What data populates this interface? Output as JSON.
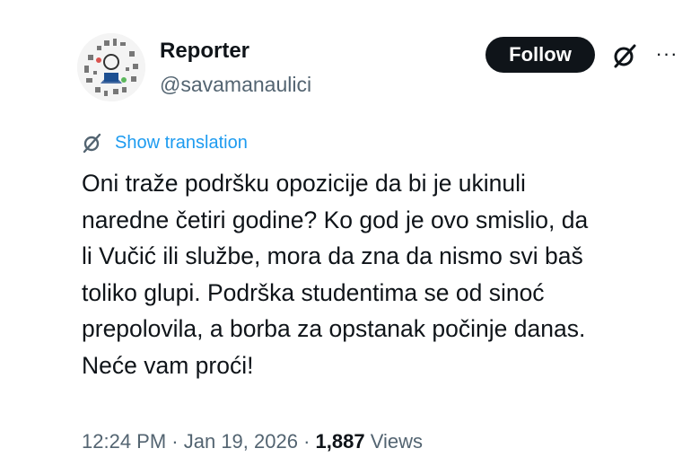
{
  "author": {
    "display_name": "Reporter",
    "handle": "@savamanaulici",
    "avatar_icon": "doodle-avatar-icon"
  },
  "actions": {
    "follow_label": "Follow",
    "grok_icon": "grok-icon",
    "more_icon": "more-icon",
    "more_glyph": "···"
  },
  "translation": {
    "icon": "translate-globe-icon",
    "link_text": "Show translation"
  },
  "tweet": {
    "lines": [
      "Oni traže podršku opozicije da bi je ukinuli",
      "naredne četiri godine? Ko god je ovo smislio, da",
      "li Vučić ili službe, mora da zna da nismo svi baš",
      "toliko glupi. Podrška studentima se od sinoć",
      "prepolovila, a borba za opstanak počinje danas.",
      "Neće vam proći!"
    ]
  },
  "meta": {
    "time": "12:24 PM",
    "separator": " · ",
    "date": "Jan 19, 2026",
    "views_count": "1,887",
    "views_label": "Views"
  },
  "colors": {
    "text": "#0f1419",
    "secondary": "#536471",
    "link": "#1d9bf0",
    "button_bg": "#0f1419",
    "button_text": "#ffffff"
  }
}
